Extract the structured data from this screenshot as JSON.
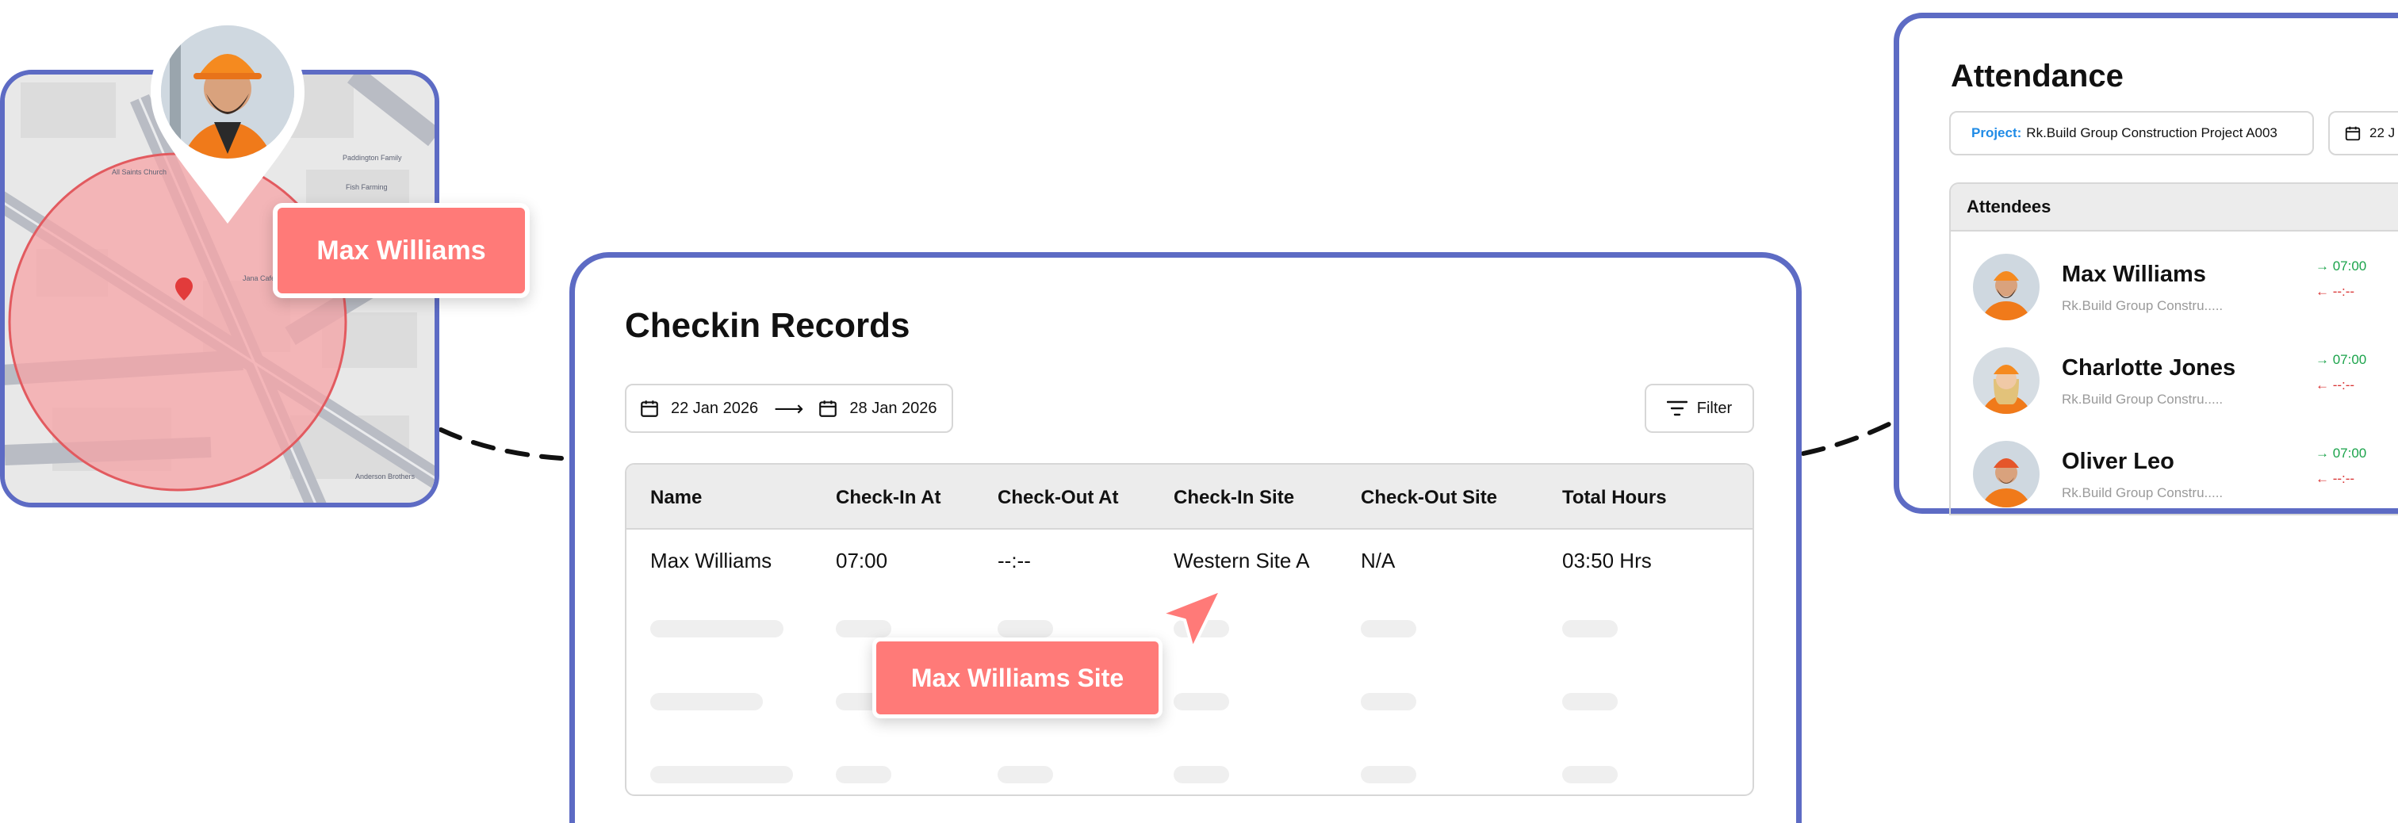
{
  "map_card": {
    "name_tag": "Max Williams"
  },
  "checkin": {
    "title": "Checkin Records",
    "date_from": "22 Jan 2026",
    "date_to": "28 Jan 2026",
    "range_arrow": "⟶",
    "filter_label": "Filter",
    "columns": [
      "Name",
      "Check-In At",
      "Check-Out At",
      "Check-In Site",
      "Check-Out Site",
      "Total Hours"
    ],
    "rows": [
      [
        "Max Williams",
        "07:00",
        "--:--",
        "Western Site A",
        "N/A",
        "03:50 Hrs"
      ]
    ],
    "site_tag": "Max Williams Site"
  },
  "attendance": {
    "title": "Attendance",
    "project_label": "Project:",
    "project_value": "Rk.Build Group Construction Project A003",
    "date_value": "22 J",
    "attendees_header": "Attendees",
    "attendees": [
      {
        "name": "Max Williams",
        "sub": "Rk.Build Group Constru.....",
        "in": "→ 07:00",
        "out": "← --:--"
      },
      {
        "name": "Charlotte Jones",
        "sub": "Rk.Build Group Constru.....",
        "in": "→ 07:00",
        "out": "← --:--"
      },
      {
        "name": "Oliver Leo",
        "sub": "Rk.Build Group Constru.....",
        "in": "→ 07:00",
        "out": "← --:--"
      }
    ]
  },
  "colors": {
    "accent_border": "#5d6bc4",
    "tag_coral": "#ff7a78",
    "checkin_green": "#1aa34a",
    "checkout_red": "#d93232",
    "project_blue": "#1f8be6"
  },
  "icons": [
    "calendar-icon",
    "arrow-right-icon",
    "filter-icon",
    "cursor-pointer-icon",
    "map-pin-icon",
    "avatar"
  ]
}
